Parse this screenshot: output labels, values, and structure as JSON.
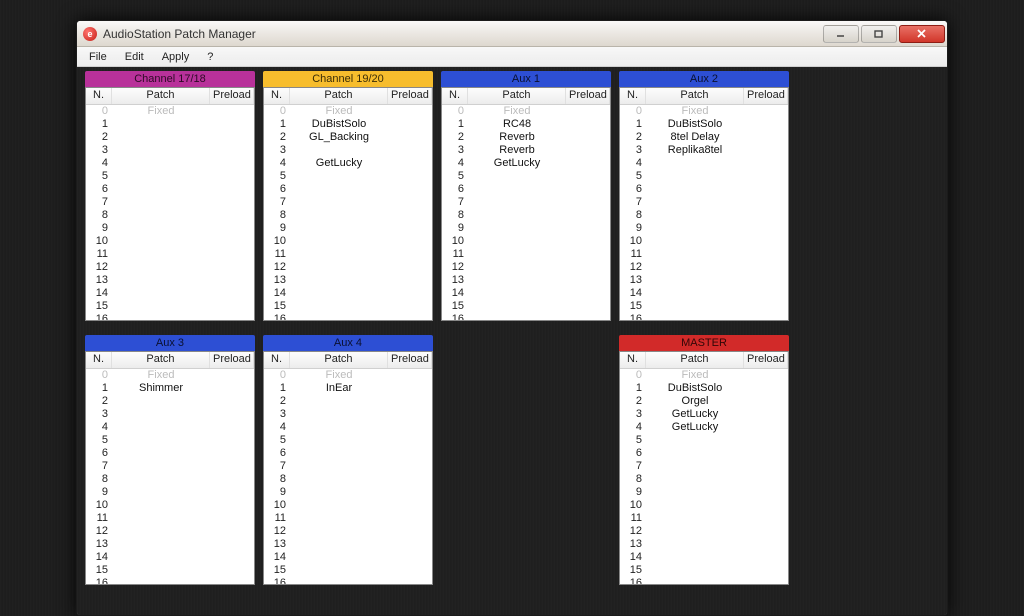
{
  "window": {
    "title": "AudioStation Patch Manager",
    "app_icon_letter": "e"
  },
  "menu": {
    "file": "File",
    "edit": "Edit",
    "apply": "Apply",
    "help": "?"
  },
  "columns": {
    "n": "N.",
    "patch": "Patch",
    "preload": "Preload"
  },
  "fixed_label": "Fixed",
  "row_count": 17,
  "panels": [
    {
      "title": "Channel 17/18",
      "color": "pink",
      "patches": {}
    },
    {
      "title": "Channel 19/20",
      "color": "yellow",
      "patches": {
        "1": "DuBistSolo",
        "2": "GL_Backing",
        "4": "GetLucky"
      }
    },
    {
      "title": "Aux 1",
      "color": "blue",
      "patches": {
        "1": "RC48",
        "2": "Reverb",
        "3": "Reverb",
        "4": "GetLucky"
      }
    },
    {
      "title": "Aux 2",
      "color": "blue",
      "patches": {
        "1": "DuBistSolo",
        "2": "8tel Delay",
        "3": "Replika8tel"
      }
    },
    {
      "title": "Aux 3",
      "color": "blue",
      "patches": {
        "1": "Shimmer"
      }
    },
    {
      "title": "Aux 4",
      "color": "blue",
      "patches": {
        "1": "InEar"
      }
    },
    {
      "title": "",
      "color": "spacer",
      "patches": {}
    },
    {
      "title": "MASTER",
      "color": "red",
      "patches": {
        "1": "DuBistSolo",
        "2": "Orgel",
        "3": "GetLucky",
        "4": "GetLucky"
      }
    }
  ]
}
